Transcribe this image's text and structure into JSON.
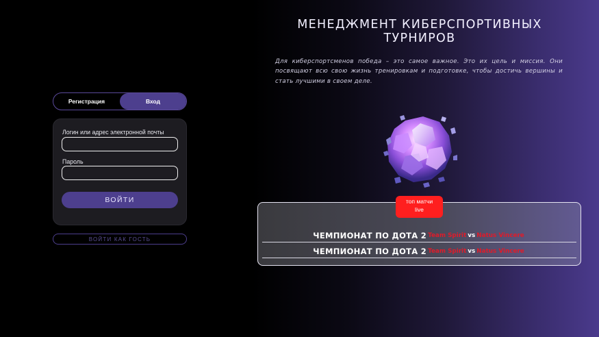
{
  "header": {
    "title": "МЕНЕДЖМЕНТ КИБЕРСПОРТИВНЫХ ТУРНИРОВ",
    "intro": "Для киберспортсменов победа – это самое важное. Это их цель и миссия. Они посвящают всю свою жизнь тренировкам и подготовке, чтобы достичь вершины и стать лучшими в своем деле."
  },
  "auth": {
    "tabs": [
      {
        "label": "Регистрация",
        "active": false
      },
      {
        "label": "Вход",
        "active": true
      }
    ],
    "login_label": "Логин или адрес электронной почты",
    "login_value": "",
    "password_label": "Пароль",
    "password_value": "",
    "submit_label": "ВОЙТИ",
    "guest_label": "ВОЙТИ КАК ГОСТЬ"
  },
  "matches": {
    "badge": "топ матчи live",
    "badge_line1": "топ матчи",
    "badge_line2": "live",
    "items": [
      {
        "title": "ЧЕМПИОНАТ ПО ДОТА 2",
        "team1": "Team Spirit",
        "vs": "vs",
        "team2": "Natus Vincere"
      },
      {
        "title": "ЧЕМПИОНАТ ПО ДОТА 2",
        "team1": "Team Spirit",
        "vs": "vs",
        "team2": "Natus Vincere"
      }
    ]
  },
  "colors": {
    "accent": "#4d3f8e",
    "badge": "#ff1f1f",
    "team": "#e01b2a"
  },
  "icons": {
    "hero": "crystal-sphere-icon"
  }
}
